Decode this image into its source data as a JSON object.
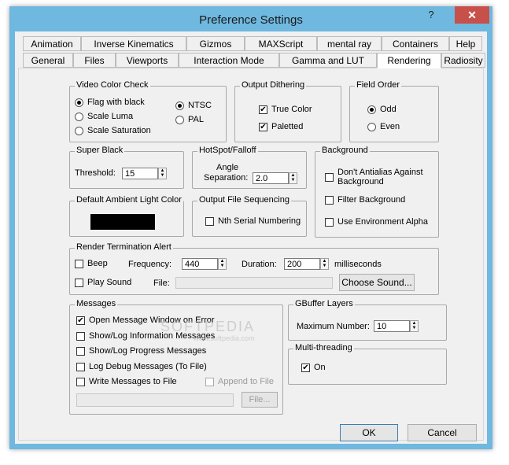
{
  "window": {
    "title": "Preference Settings",
    "help_glyph": "?",
    "close_glyph": "✕"
  },
  "tabs_row1": [
    "Animation",
    "Inverse Kinematics",
    "Gizmos",
    "MAXScript",
    "mental ray",
    "Containers",
    "Help"
  ],
  "tabs_row2": [
    "General",
    "Files",
    "Viewports",
    "Interaction Mode",
    "Gamma and LUT",
    "Rendering",
    "Radiosity"
  ],
  "active_tab": "Rendering",
  "video_color_check": {
    "title": "Video Color Check",
    "flag_black": "Flag with black",
    "scale_luma": "Scale Luma",
    "scale_saturation": "Scale Saturation",
    "ntsc": "NTSC",
    "pal": "PAL"
  },
  "output_dithering": {
    "title": "Output Dithering",
    "true_color": "True Color",
    "paletted": "Paletted"
  },
  "field_order": {
    "title": "Field Order",
    "odd": "Odd",
    "even": "Even"
  },
  "super_black": {
    "title": "Super Black",
    "threshold_label": "Threshold:",
    "threshold_value": "15"
  },
  "hotspot": {
    "title": "HotSpot/Falloff",
    "label1": "Angle",
    "label2": "Separation:",
    "value": "2.0"
  },
  "background": {
    "title": "Background",
    "dont_antialias_1": "Don't Antialias Against",
    "dont_antialias_2": "Background",
    "filter_bg": "Filter Background",
    "env_alpha": "Use Environment Alpha"
  },
  "ambient": {
    "title": "Default Ambient Light Color",
    "color": "#000000"
  },
  "output_seq": {
    "title": "Output File Sequencing",
    "nth": "Nth Serial Numbering"
  },
  "render_alert": {
    "title": "Render Termination Alert",
    "beep": "Beep",
    "frequency_label": "Frequency:",
    "frequency_value": "440",
    "duration_label": "Duration:",
    "duration_value": "200",
    "ms": "milliseconds",
    "play_sound": "Play Sound",
    "file_label": "File:",
    "choose_sound": "Choose Sound..."
  },
  "messages": {
    "title": "Messages",
    "open_window": "Open Message Window on Error",
    "info": "Show/Log Information Messages",
    "progress": "Show/Log Progress Messages",
    "debug": "Log Debug Messages (To File)",
    "write": "Write Messages to File",
    "append": "Append to File",
    "file_btn": "File..."
  },
  "gbuffer": {
    "title": "GBuffer Layers",
    "max_label": "Maximum Number:",
    "max_value": "10"
  },
  "multithreading": {
    "title": "Multi-threading",
    "on": "On"
  },
  "buttons": {
    "ok": "OK",
    "cancel": "Cancel"
  },
  "watermark": {
    "text": "SOFTPEDIA",
    "sub": "www.softpedia.com"
  },
  "check_glyph": "✔"
}
